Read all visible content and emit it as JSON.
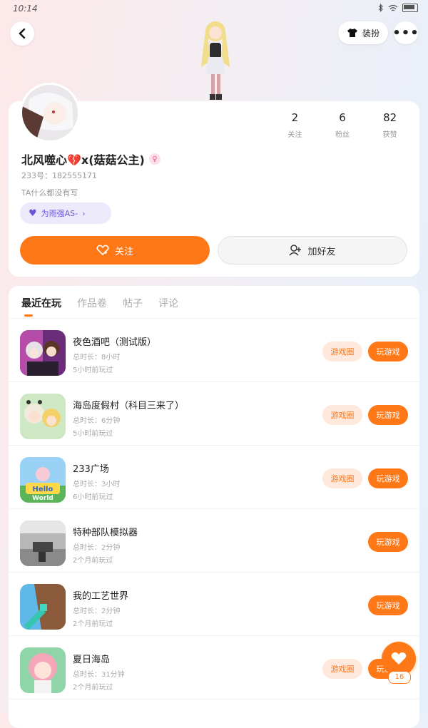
{
  "status_bar": {
    "time": "10:14",
    "bluetooth_icon": "bluetooth-icon",
    "wifi_icon": "wifi-icon",
    "battery_icon": "battery-icon"
  },
  "topbar": {
    "back_icon": "chevron-left-icon",
    "dress_label": "装扮",
    "dress_icon": "tshirt-icon",
    "more_icon": "more-horizontal-icon"
  },
  "profile": {
    "nickname": "北风噬心💔x(菇菇公主)",
    "gender_icon": "female-icon",
    "uid": "233号：182555171",
    "bio": "TA什么都没有写",
    "tag_label": "为雨强AS-",
    "tag_icon": "purple-heart-icon",
    "stats": [
      {
        "value": "2",
        "label": "关注"
      },
      {
        "value": "6",
        "label": "粉丝"
      },
      {
        "value": "82",
        "label": "获赞"
      }
    ],
    "follow_label": "关注",
    "add_friend_label": "加好友"
  },
  "tabs": [
    "最近在玩",
    "作品卷",
    "帖子",
    "评论"
  ],
  "games": [
    {
      "name": "夜色酒吧（测试版）",
      "duration": "总时长：8小时",
      "last_played": "5小时前玩过",
      "circle_label": "游戏圈",
      "play_label": "玩游戏",
      "has_circle": true
    },
    {
      "name": "海岛度假村（科目三来了）",
      "duration": "总时长：6分钟",
      "last_played": "5小时前玩过",
      "circle_label": "游戏圈",
      "play_label": "玩游戏",
      "has_circle": true
    },
    {
      "name": "233广场",
      "duration": "总时长：3小时",
      "last_played": "6小时前玩过",
      "circle_label": "游戏圈",
      "play_label": "玩游戏",
      "has_circle": true
    },
    {
      "name": "特种部队模拟器",
      "duration": "总时长：2分钟",
      "last_played": "2个月前玩过",
      "circle_label": "",
      "play_label": "玩游戏",
      "has_circle": false
    },
    {
      "name": "我的工艺世界",
      "duration": "总时长：2分钟",
      "last_played": "2个月前玩过",
      "circle_label": "",
      "play_label": "玩游戏",
      "has_circle": false
    },
    {
      "name": "夏日海岛",
      "duration": "总时长：31分钟",
      "last_played": "2个月前玩过",
      "circle_label": "游戏圈",
      "play_label": "玩游戏",
      "has_circle": true
    }
  ],
  "fab": {
    "icon": "heart-icon",
    "count": "16"
  },
  "colors": {
    "accent": "#ff7818",
    "accent_light": "#ffe8dc",
    "tag_bg": "#ece9fb",
    "tag_text": "#6b55d6"
  }
}
